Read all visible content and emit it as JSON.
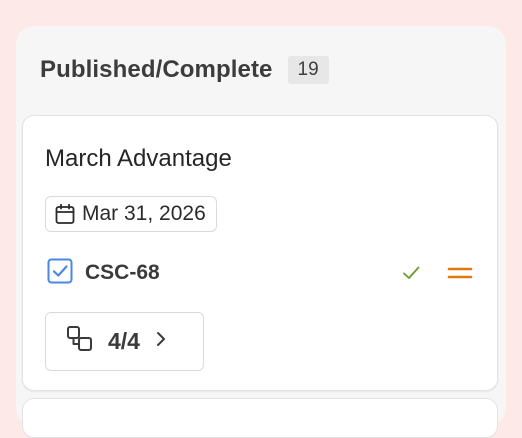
{
  "column": {
    "title": "Published/Complete",
    "count": "19"
  },
  "card": {
    "title": "March Advantage",
    "due_date": "Mar 31, 2026",
    "issue_key": "CSC-68",
    "issue_type_icon": "checkbox-icon",
    "status_icon": "check-icon",
    "priority_icon": "priority-medium-icon",
    "subtasks": "4/4"
  },
  "colors": {
    "background": "#fde9e7",
    "checkbox_blue": "#4a86e8",
    "check_green": "#6a9a2a",
    "priority_orange": "#e07a10"
  }
}
